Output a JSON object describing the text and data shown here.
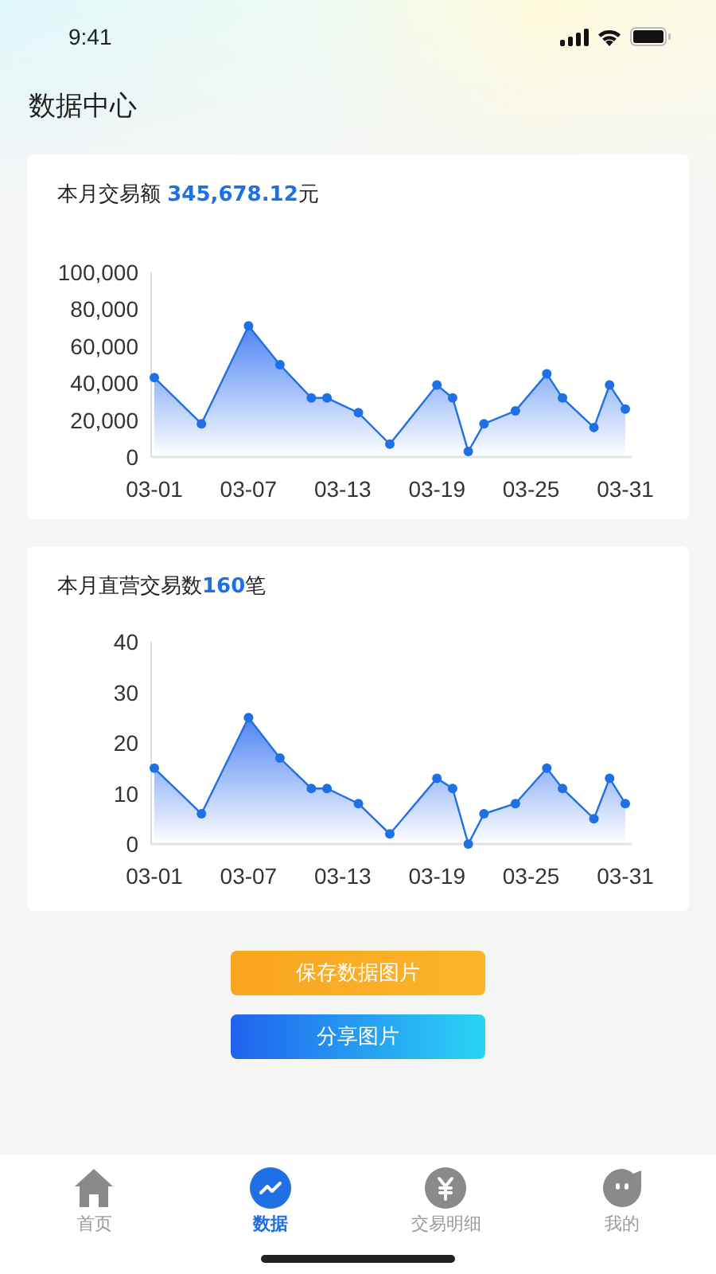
{
  "status_bar": {
    "time": "9:41"
  },
  "page_title": "数据中心",
  "cards": [
    {
      "title": {
        "label": "本月交易额 ",
        "value": "345,678.12",
        "unit": "元"
      },
      "chart_data": {
        "type": "area",
        "categories": [
          "03-01",
          null,
          null,
          null,
          null,
          null,
          "03-07",
          null,
          null,
          null,
          null,
          null,
          "03-13",
          null,
          null,
          null,
          null,
          null,
          "03-19",
          null,
          null,
          null,
          null,
          null,
          "03-25",
          null,
          null,
          null,
          null,
          null,
          "03-31"
        ],
        "series": [
          {
            "color": "#1f6fe5",
            "values": [
              43000,
              null,
              null,
              18000,
              null,
              null,
              71000,
              null,
              50000,
              null,
              32000,
              32000,
              null,
              24000,
              null,
              7000,
              null,
              null,
              39000,
              32000,
              3000,
              18000,
              null,
              25000,
              null,
              45000,
              32000,
              null,
              16000,
              39000,
              26000
            ]
          }
        ],
        "ylim": [
          0,
          100000
        ],
        "yticks": [
          {
            "value": 0,
            "label": "0"
          },
          {
            "value": 20000,
            "label": "20,000"
          },
          {
            "value": 40000,
            "label": "40,000"
          },
          {
            "value": 60000,
            "label": "60,000"
          },
          {
            "value": 80000,
            "label": "80,000"
          },
          {
            "value": 100000,
            "label": "100,000"
          }
        ]
      }
    },
    {
      "title": {
        "label": "本月直营交易数",
        "value": "160",
        "unit": "笔"
      },
      "chart_data": {
        "type": "area",
        "categories": [
          "03-01",
          null,
          null,
          null,
          null,
          null,
          "03-07",
          null,
          null,
          null,
          null,
          null,
          "03-13",
          null,
          null,
          null,
          null,
          null,
          "03-19",
          null,
          null,
          null,
          null,
          null,
          "03-25",
          null,
          null,
          null,
          null,
          null,
          "03-31"
        ],
        "series": [
          {
            "color": "#1f6fe5",
            "values": [
              15,
              null,
              null,
              6,
              null,
              null,
              25,
              null,
              17,
              null,
              11,
              11,
              null,
              8,
              null,
              2,
              null,
              null,
              13,
              11,
              0,
              6,
              null,
              8,
              null,
              15,
              11,
              null,
              5,
              13,
              8
            ]
          }
        ],
        "ylim": [
          0,
          40
        ],
        "yticks": [
          0,
          10,
          20,
          30,
          40
        ]
      }
    }
  ],
  "buttons": [
    {
      "label": "保存数据图片",
      "kind": "save"
    },
    {
      "label": "分享图片",
      "kind": "share"
    }
  ],
  "tab_bar": [
    {
      "label": "首页",
      "selected": false
    },
    {
      "label": "数据",
      "selected": true
    },
    {
      "label": "交易明细",
      "selected": false
    },
    {
      "label": "我的",
      "selected": false
    }
  ]
}
